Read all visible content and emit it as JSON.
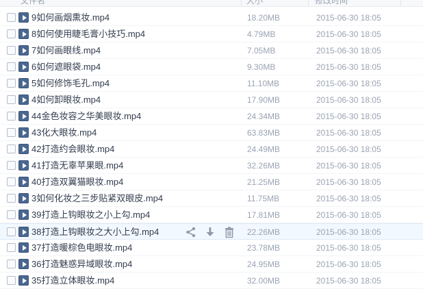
{
  "header": {
    "name_label": "文件名",
    "size_label": "大小",
    "time_label": "修改时间"
  },
  "files": [
    {
      "name": "9如何画烟熏妆.mp4",
      "size": "18.20MB",
      "time": "2015-06-30 18:05"
    },
    {
      "name": "8如何使用睫毛膏小技巧.mp4",
      "size": "4.79MB",
      "time": "2015-06-30 18:05"
    },
    {
      "name": "7如何画眼线.mp4",
      "size": "7.05MB",
      "time": "2015-06-30 18:05"
    },
    {
      "name": "6如何遮眼袋.mp4",
      "size": "9.30MB",
      "time": "2015-06-30 18:05"
    },
    {
      "name": "5如何修饰毛孔.mp4",
      "size": "11.10MB",
      "time": "2015-06-30 18:05"
    },
    {
      "name": "4如何卸眼妆.mp4",
      "size": "17.90MB",
      "time": "2015-06-30 18:05"
    },
    {
      "name": "44金色妆容之华美眼妆.mp4",
      "size": "24.34MB",
      "time": "2015-06-30 18:05"
    },
    {
      "name": "43化大眼妆.mp4",
      "size": "63.83MB",
      "time": "2015-06-30 18:05"
    },
    {
      "name": "42打造约会眼妆.mp4",
      "size": "24.49MB",
      "time": "2015-06-30 18:05"
    },
    {
      "name": "41打造无辜苹果眼.mp4",
      "size": "32.26MB",
      "time": "2015-06-30 18:05"
    },
    {
      "name": "40打造双翼猫眼妆.mp4",
      "size": "21.25MB",
      "time": "2015-06-30 18:05"
    },
    {
      "name": "3如何化妆之三步贴紧双眼皮.mp4",
      "size": "11.75MB",
      "time": "2015-06-30 18:05"
    },
    {
      "name": "39打造上钩眼妆之小上勾.mp4",
      "size": "17.81MB",
      "time": "2015-06-30 18:05"
    },
    {
      "name": "38打造上钩眼妆之大小上勾.mp4",
      "size": "22.26MB",
      "time": "2015-06-30 18:05",
      "hover": true
    },
    {
      "name": "37打造暖棕色电眼妆.mp4",
      "size": "23.78MB",
      "time": "2015-06-30 18:05"
    },
    {
      "name": "36打造魅惑异域眼妆.mp4",
      "size": "24.95MB",
      "time": "2015-06-30 18:05"
    },
    {
      "name": "35打造立体眼妆.mp4",
      "size": "32.00MB",
      "time": "2015-06-30 18:05"
    }
  ],
  "row_actions": {
    "share_icon": "share-icon",
    "download_icon": "download-icon",
    "delete_icon": "trash-icon"
  },
  "colors": {
    "file_icon": "#4a6791",
    "hover_row": "#f2f8ff",
    "meta_text": "#9aa3b3"
  }
}
